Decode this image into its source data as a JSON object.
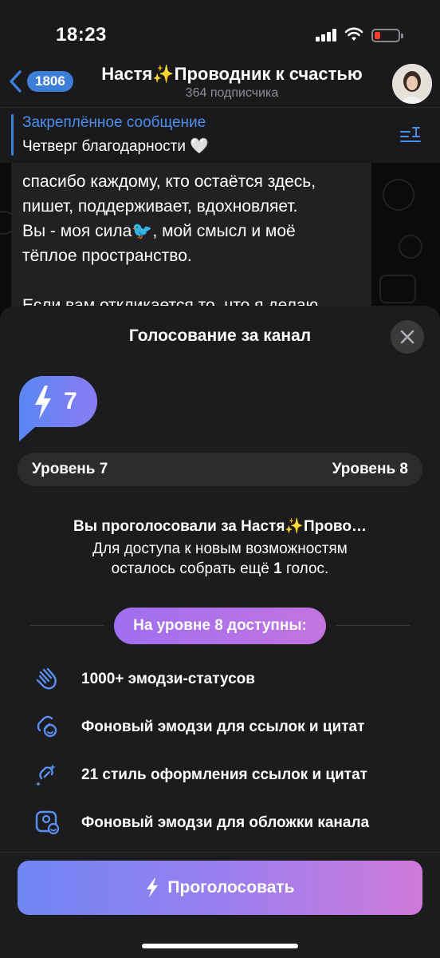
{
  "status_bar": {
    "time": "18:23",
    "icons": [
      "signal-icon",
      "wifi-icon",
      "battery-icon"
    ],
    "battery_color": "#ff3b30"
  },
  "header": {
    "back_icon": "chevron-left-icon",
    "unread_count": "1806",
    "title": "Настя✨Проводник к счастью",
    "subtitle": "364 подписчика",
    "accent": "#3e7ed8"
  },
  "pinned": {
    "title": "Закреплённое сообщение",
    "text": "Четверг благодарности 🤍",
    "icon": "pin-list-icon"
  },
  "message": {
    "lines": [
      "спасибо каждому, кто остаётся здесь,",
      "пишет, поддерживает, вдохновляет.",
      "Вы - моя сила🐦, мой смысл и моё",
      "тёплое пространство.",
      "",
      "Если вам откликается то, что я делаю"
    ]
  },
  "sheet": {
    "title": "Голосование за канал",
    "close_icon": "close-icon",
    "current_level": "7",
    "level_icon": "lightning-icon",
    "level_from": "Уровень 7",
    "level_to": "Уровень 8",
    "voted_title": "Вы проголосовали за Настя✨Прово…",
    "voted_line1": "Для доступа к новым возможностям",
    "voted_line2_prefix": "осталось собрать ещё ",
    "voted_line2_count": "1",
    "voted_line2_suffix": " голос.",
    "unlock_label": "На уровне 8 доступны:",
    "features": [
      {
        "icon": "wave-hand-icon",
        "label": "1000+ эмодзи-статусов"
      },
      {
        "icon": "link-emoji-icon",
        "label": "Фоновый эмодзи для ссылок и цитат"
      },
      {
        "icon": "link-sparkle-icon",
        "label": "21 стиль оформления ссылок и цитат"
      },
      {
        "icon": "cover-emoji-icon",
        "label": "Фоновый эмодзи для обложки канала"
      }
    ],
    "vote_button_label": "Проголосовать",
    "vote_button_icon": "lightning-icon",
    "accent_gradient": [
      "#6f86f3",
      "#9a7ff0",
      "#cf7ad9"
    ],
    "feature_icon_color": "#5a8ff5"
  }
}
